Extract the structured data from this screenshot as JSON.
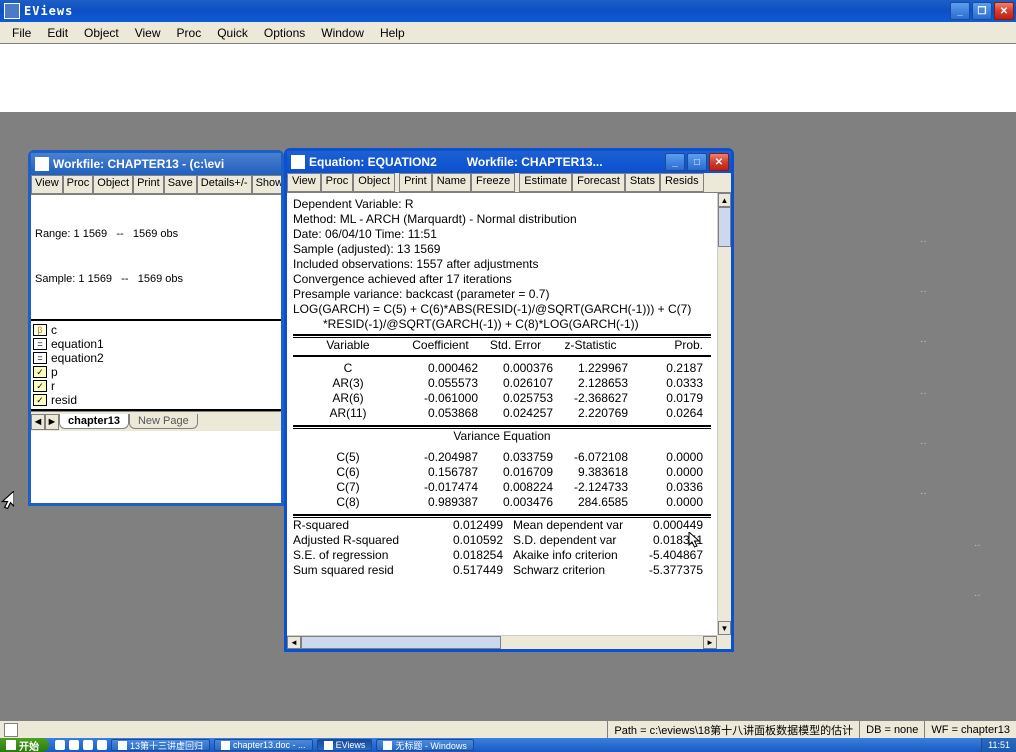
{
  "app": {
    "title": "EViews"
  },
  "menu": [
    "File",
    "Edit",
    "Object",
    "View",
    "Proc",
    "Quick",
    "Options",
    "Window",
    "Help"
  ],
  "workfile": {
    "title": "Workfile: CHAPTER13 - (c:\\evi",
    "toolbar": [
      "View",
      "Proc",
      "Object",
      "Print",
      "Save",
      "Details+/-",
      "Show"
    ],
    "range": "Range: 1 1569   --   1569 obs",
    "sample": "Sample: 1 1569   --   1569 obs",
    "items": [
      {
        "icon": "beta",
        "label": "c"
      },
      {
        "icon": "eq",
        "label": "equation1"
      },
      {
        "icon": "eq",
        "label": "equation2"
      },
      {
        "icon": "check",
        "label": "p"
      },
      {
        "icon": "check",
        "label": "r"
      },
      {
        "icon": "check",
        "label": "resid"
      }
    ],
    "tab_active": "chapter13",
    "tab_new": "New Page"
  },
  "equation": {
    "title1": "Equation: EQUATION2",
    "title2": "Workfile: CHAPTER13...",
    "toolbar": [
      "View",
      "Proc",
      "Object",
      "Print",
      "Name",
      "Freeze",
      "Estimate",
      "Forecast",
      "Stats",
      "Resids"
    ],
    "lines": [
      "Dependent Variable: R",
      "Method: ML - ARCH (Marquardt) - Normal distribution",
      "Date: 06/04/10   Time: 11:51",
      "Sample (adjusted): 13 1569",
      "Included observations: 1557 after adjustments",
      "Convergence achieved after 17 iterations",
      "Presample variance: backcast (parameter = 0.7)",
      "LOG(GARCH) = C(5) + C(6)*ABS(RESID(-1)/@SQRT(GARCH(-1))) + C(7)",
      "*RESID(-1)/@SQRT(GARCH(-1)) + C(8)*LOG(GARCH(-1))"
    ],
    "hdr": [
      "Variable",
      "Coefficient",
      "Std. Error",
      "z-Statistic",
      "Prob."
    ],
    "coef_rows": [
      [
        "C",
        "0.000462",
        "0.000376",
        "1.229967",
        "0.2187"
      ],
      [
        "AR(3)",
        "0.055573",
        "0.026107",
        "2.128653",
        "0.0333"
      ],
      [
        "AR(6)",
        "-0.061000",
        "0.025753",
        "-2.368627",
        "0.0179"
      ],
      [
        "AR(11)",
        "0.053868",
        "0.024257",
        "2.220769",
        "0.0264"
      ]
    ],
    "var_title": "Variance Equation",
    "var_rows": [
      [
        "C(5)",
        "-0.204987",
        "0.033759",
        "-6.072108",
        "0.0000"
      ],
      [
        "C(6)",
        "0.156787",
        "0.016709",
        "9.383618",
        "0.0000"
      ],
      [
        "C(7)",
        "-0.017474",
        "0.008224",
        "-2.124733",
        "0.0336"
      ],
      [
        "C(8)",
        "0.989387",
        "0.003476",
        "284.6585",
        "0.0000"
      ]
    ],
    "stats": [
      [
        "R-squared",
        "0.012499",
        "Mean dependent var",
        "0.000449"
      ],
      [
        "Adjusted R-squared",
        "0.010592",
        "S.D. dependent var",
        "0.018351"
      ],
      [
        "S.E. of regression",
        "0.018254",
        "Akaike info criterion",
        "-5.404867"
      ],
      [
        "Sum squared resid",
        "0.517449",
        "Schwarz criterion",
        "-5.377375"
      ]
    ]
  },
  "statusbar": {
    "path": "Path = c:\\eviews\\18第十八讲面板数据模型的估计",
    "db": "DB = none",
    "wf": "WF = chapter13"
  },
  "taskbar": {
    "start": "开始",
    "tasks": [
      "13第十三讲虚回归",
      "chapter13.doc - ...",
      "EViews",
      "无标题 - Windows"
    ],
    "time": "11:51"
  }
}
